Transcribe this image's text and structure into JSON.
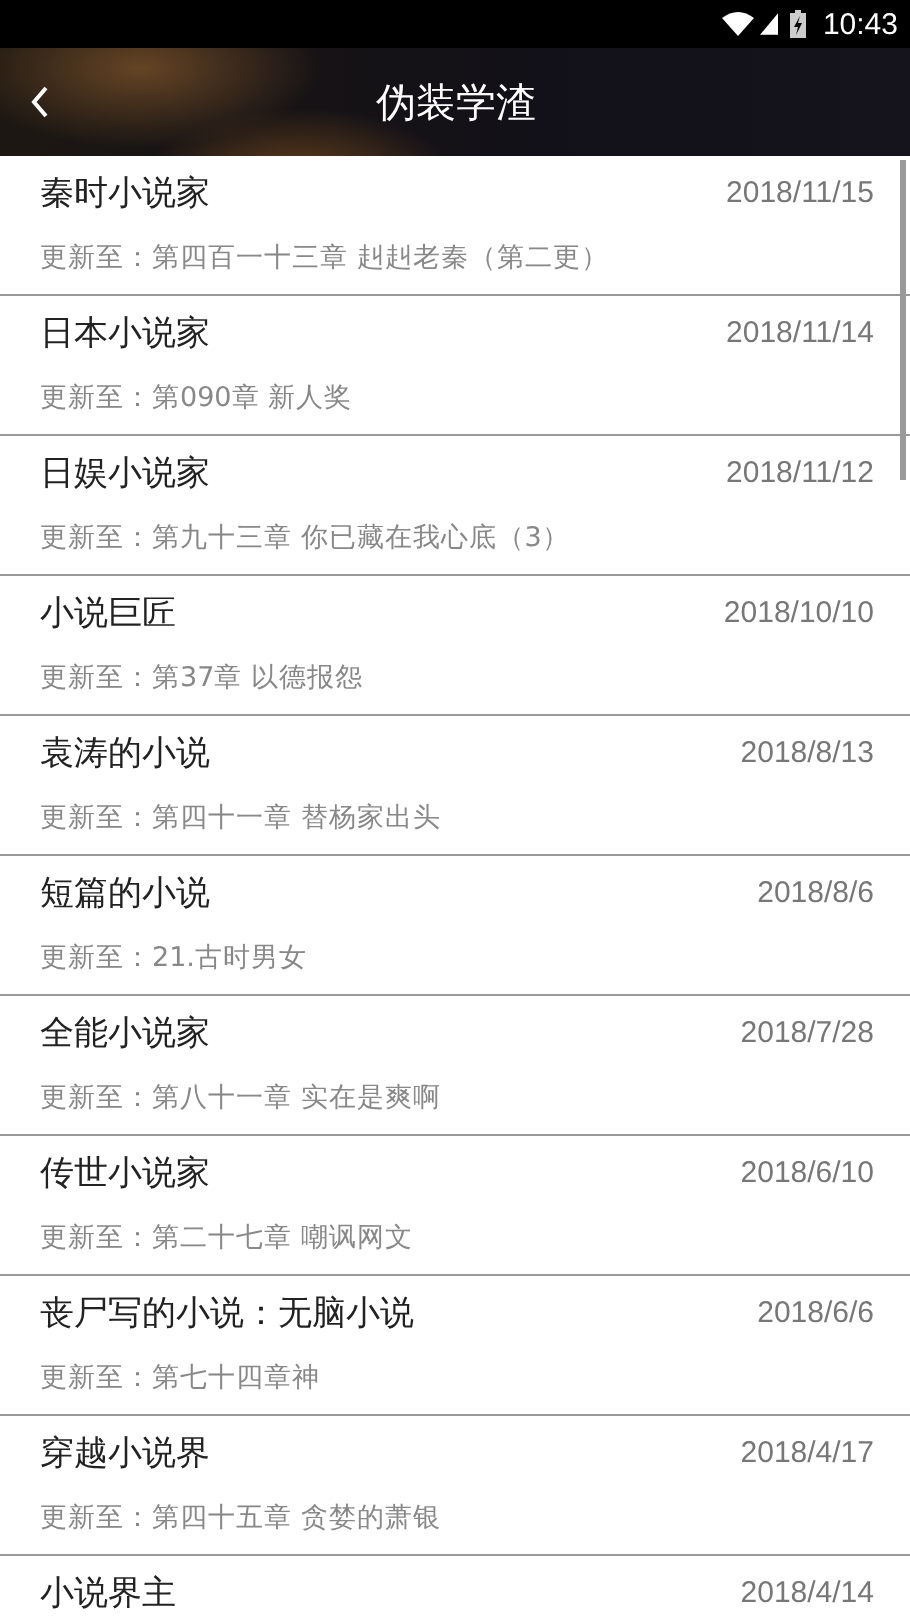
{
  "status_bar": {
    "time": "10:43"
  },
  "app_bar": {
    "title": "伪装学渣"
  },
  "novels": [
    {
      "title": "秦时小说家",
      "date": "2018/11/15",
      "update": "更新至：第四百一十三章 赳赳老秦（第二更）"
    },
    {
      "title": "日本小说家",
      "date": "2018/11/14",
      "update": "更新至：第090章 新人奖"
    },
    {
      "title": "日娱小说家",
      "date": "2018/11/12",
      "update": "更新至：第九十三章 你已藏在我心底（3）"
    },
    {
      "title": "小说巨匠",
      "date": "2018/10/10",
      "update": "更新至：第37章 以德报怨"
    },
    {
      "title": "袁涛的小说",
      "date": "2018/8/13",
      "update": "更新至：第四十一章 替杨家出头"
    },
    {
      "title": "短篇的小说",
      "date": "2018/8/6",
      "update": "更新至：21.古时男女"
    },
    {
      "title": "全能小说家",
      "date": "2018/7/28",
      "update": "更新至：第八十一章 实在是爽啊"
    },
    {
      "title": "传世小说家",
      "date": "2018/6/10",
      "update": "更新至：第二十七章 嘲讽网文"
    },
    {
      "title": "丧尸写的小说：无脑小说",
      "date": "2018/6/6",
      "update": "更新至：第七十四章神"
    },
    {
      "title": "穿越小说界",
      "date": "2018/4/17",
      "update": "更新至：第四十五章 贪婪的萧银"
    },
    {
      "title": "小说界主",
      "date": "2018/4/14"
    }
  ]
}
